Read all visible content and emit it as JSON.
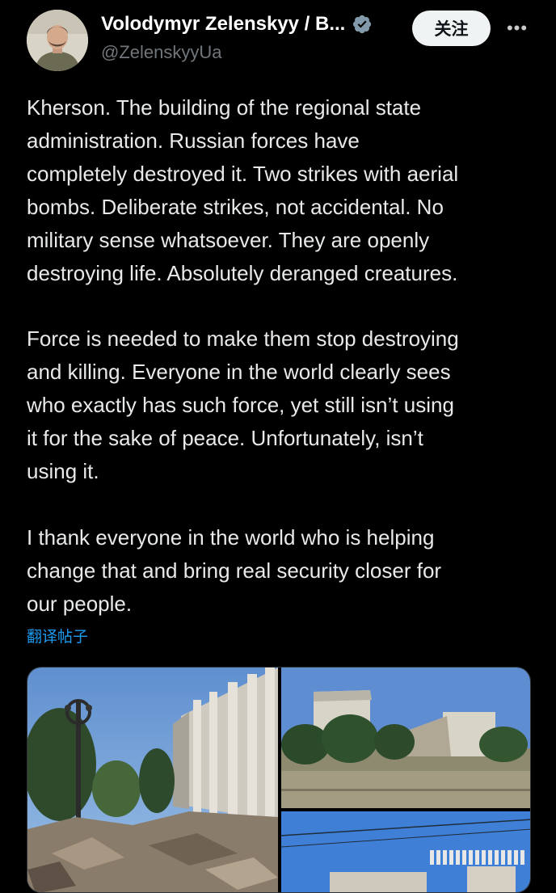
{
  "author": {
    "display_name": "Volodymyr Zelenskyy / B...",
    "handle": "@ZelenskyyUa",
    "verified": true
  },
  "actions": {
    "follow_label": "关注",
    "more_icon": "more-horizontal-icon",
    "more_label": "•••"
  },
  "tweet": {
    "paragraphs": [
      {
        "lines": [
          "Kherson. The building of the regional state",
          "administration. Russian forces have",
          "completely destroyed it. Two strikes with aerial",
          "bombs. Deliberate strikes, not accidental. No",
          "military sense whatsoever. They are openly",
          "destroying life. Absolutely deranged creatures."
        ]
      },
      {
        "lines": [
          "Force is needed to make them stop destroying",
          "and killing. Everyone in the world clearly sees",
          "who exactly has such force, yet still isn’t using",
          "it for the sake of peace. Unfortunately, isn’t",
          "using it."
        ]
      },
      {
        "lines": [
          "I thank everyone in the world who is helping",
          "change that and bring real security closer for",
          "our people."
        ]
      }
    ],
    "translate_label": "翻译帖子"
  },
  "media": {
    "photos": [
      {
        "name": "photo-building-ruins-street"
      },
      {
        "name": "photo-building-distant-view"
      },
      {
        "name": "photo-building-sky-wires"
      }
    ]
  },
  "colors": {
    "background": "#000000",
    "text": "#e7e9ea",
    "secondary": "#71767b",
    "link": "#1d9bf0",
    "verified": "#829aab",
    "follow_bg": "#eff3f4"
  }
}
